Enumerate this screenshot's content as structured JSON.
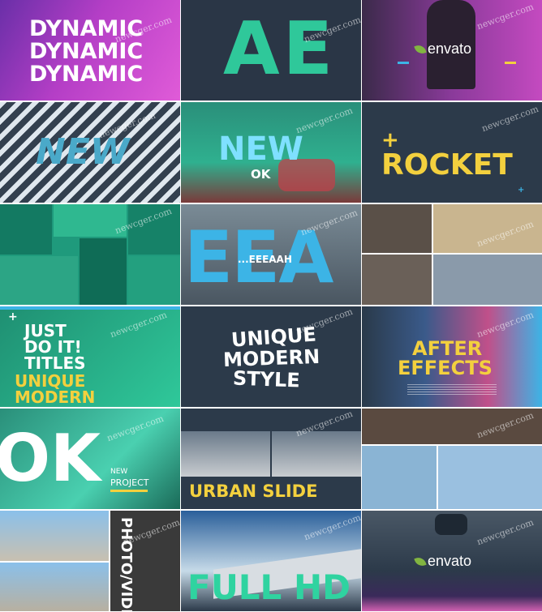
{
  "tiles": {
    "t1": {
      "lines": [
        "DYNAMIC",
        "DYNAMIC",
        "DYNAMIC"
      ]
    },
    "t2": {
      "text": "AE"
    },
    "t3": {
      "brand": "envato"
    },
    "t4": {
      "text": "NEW"
    },
    "t5": {
      "text": "NEW",
      "small": "OK"
    },
    "t6": {
      "plus": "+",
      "text": "ROCKET",
      "mark": "+"
    },
    "t8": {
      "big": "EEA",
      "small": "...EEEAAH"
    },
    "t10": {
      "plus": "+",
      "line1": "JUST",
      "line2": "DO IT!",
      "line3": "TITLES",
      "line4": "UNIQUE",
      "line5": "MODERN"
    },
    "t11": {
      "lines": [
        "UNIQUE",
        "MODERN",
        "STYLE"
      ]
    },
    "t12": {
      "line1": "AFTER",
      "line2": "EFFECTS"
    },
    "t13": {
      "big": "OK",
      "small1": "NEW",
      "small2": "PROJECT"
    },
    "t14": {
      "text": "URBAN SLIDE"
    },
    "t16": {
      "text": "PHOTO/VIDEO"
    },
    "t17": {
      "text": "FULL HD"
    },
    "t18": {
      "brand": "envato"
    }
  },
  "watermark": "newcger.com",
  "colors": {
    "teal": "#2fd3a0",
    "yellow": "#f3d03e",
    "blue": "#3cb4e6",
    "magenta": "#c63fb8",
    "navy": "#2c3a4a"
  }
}
